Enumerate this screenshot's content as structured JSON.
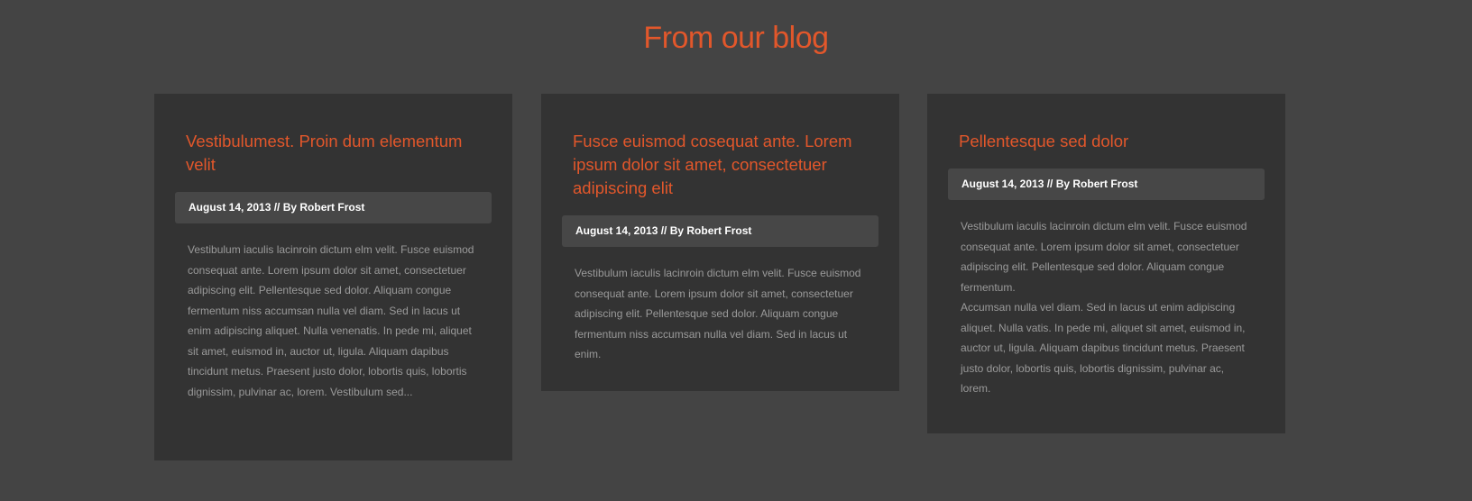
{
  "section": {
    "title": "From our blog"
  },
  "posts": [
    {
      "title": "Vestibulumest. Proin dum elementum velit",
      "meta": "August 14, 2013 // By Robert Frost",
      "excerpt": "Vestibulum iaculis lacinroin dictum elm velit. Fusce euismod consequat ante. Lorem ipsum dolor sit amet, consectetuer adipiscing elit. Pellentesque sed dolor. Aliquam congue fermentum niss accumsan nulla vel diam. Sed in lacus ut enim adipiscing aliquet. Nulla venenatis. In pede mi, aliquet sit amet, euismod in, auctor ut, ligula. Aliquam dapibus tincidunt metus. Praesent justo dolor, lobortis quis, lobortis dignissim, pulvinar ac, lorem. Vestibulum sed..."
    },
    {
      "title": "Fusce euismod cosequat ante. Lorem ipsum dolor sit amet, consectetuer adipiscing elit",
      "meta": "August 14, 2013 // By Robert Frost",
      "excerpt": "Vestibulum iaculis lacinroin dictum elm velit. Fusce euismod consequat ante. Lorem ipsum dolor sit amet, consectetuer adipiscing elit. Pellentesque sed dolor. Aliquam congue fermentum niss accumsan nulla vel diam. Sed in lacus ut enim."
    },
    {
      "title": "Pellentesque sed dolor",
      "meta": "August 14, 2013 // By Robert Frost",
      "excerpt": "Vestibulum iaculis lacinroin dictum elm velit. Fusce euismod consequat ante. Lorem ipsum dolor sit amet, consectetuer adipiscing elit. Pellentesque sed dolor. Aliquam congue fermentum.",
      "excerpt2": "Accumsan nulla vel diam. Sed in lacus ut enim adipiscing aliquet. Nulla vatis. In pede mi, aliquet sit amet, euismod in, auctor ut, ligula. Aliquam dapibus tincidunt metus. Praesent justo dolor, lobortis quis, lobortis dignissim, pulvinar ac, lorem."
    }
  ],
  "colors": {
    "background": "#444444",
    "card": "#333333",
    "accent": "#e2572b",
    "meta_bar": "#474747",
    "body_text": "#9a9a9a"
  }
}
